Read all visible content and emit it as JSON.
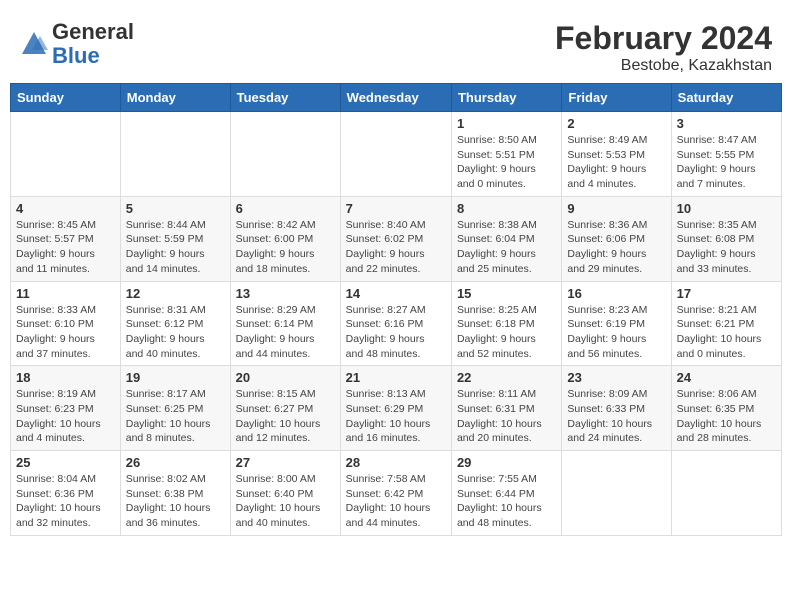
{
  "header": {
    "logo_general": "General",
    "logo_blue": "Blue",
    "month_title": "February 2024",
    "location": "Bestobe, Kazakhstan"
  },
  "weekdays": [
    "Sunday",
    "Monday",
    "Tuesday",
    "Wednesday",
    "Thursday",
    "Friday",
    "Saturday"
  ],
  "weeks": [
    [
      {
        "day": "",
        "info": ""
      },
      {
        "day": "",
        "info": ""
      },
      {
        "day": "",
        "info": ""
      },
      {
        "day": "",
        "info": ""
      },
      {
        "day": "1",
        "info": "Sunrise: 8:50 AM\nSunset: 5:51 PM\nDaylight: 9 hours\nand 0 minutes."
      },
      {
        "day": "2",
        "info": "Sunrise: 8:49 AM\nSunset: 5:53 PM\nDaylight: 9 hours\nand 4 minutes."
      },
      {
        "day": "3",
        "info": "Sunrise: 8:47 AM\nSunset: 5:55 PM\nDaylight: 9 hours\nand 7 minutes."
      }
    ],
    [
      {
        "day": "4",
        "info": "Sunrise: 8:45 AM\nSunset: 5:57 PM\nDaylight: 9 hours\nand 11 minutes."
      },
      {
        "day": "5",
        "info": "Sunrise: 8:44 AM\nSunset: 5:59 PM\nDaylight: 9 hours\nand 14 minutes."
      },
      {
        "day": "6",
        "info": "Sunrise: 8:42 AM\nSunset: 6:00 PM\nDaylight: 9 hours\nand 18 minutes."
      },
      {
        "day": "7",
        "info": "Sunrise: 8:40 AM\nSunset: 6:02 PM\nDaylight: 9 hours\nand 22 minutes."
      },
      {
        "day": "8",
        "info": "Sunrise: 8:38 AM\nSunset: 6:04 PM\nDaylight: 9 hours\nand 25 minutes."
      },
      {
        "day": "9",
        "info": "Sunrise: 8:36 AM\nSunset: 6:06 PM\nDaylight: 9 hours\nand 29 minutes."
      },
      {
        "day": "10",
        "info": "Sunrise: 8:35 AM\nSunset: 6:08 PM\nDaylight: 9 hours\nand 33 minutes."
      }
    ],
    [
      {
        "day": "11",
        "info": "Sunrise: 8:33 AM\nSunset: 6:10 PM\nDaylight: 9 hours\nand 37 minutes."
      },
      {
        "day": "12",
        "info": "Sunrise: 8:31 AM\nSunset: 6:12 PM\nDaylight: 9 hours\nand 40 minutes."
      },
      {
        "day": "13",
        "info": "Sunrise: 8:29 AM\nSunset: 6:14 PM\nDaylight: 9 hours\nand 44 minutes."
      },
      {
        "day": "14",
        "info": "Sunrise: 8:27 AM\nSunset: 6:16 PM\nDaylight: 9 hours\nand 48 minutes."
      },
      {
        "day": "15",
        "info": "Sunrise: 8:25 AM\nSunset: 6:18 PM\nDaylight: 9 hours\nand 52 minutes."
      },
      {
        "day": "16",
        "info": "Sunrise: 8:23 AM\nSunset: 6:19 PM\nDaylight: 9 hours\nand 56 minutes."
      },
      {
        "day": "17",
        "info": "Sunrise: 8:21 AM\nSunset: 6:21 PM\nDaylight: 10 hours\nand 0 minutes."
      }
    ],
    [
      {
        "day": "18",
        "info": "Sunrise: 8:19 AM\nSunset: 6:23 PM\nDaylight: 10 hours\nand 4 minutes."
      },
      {
        "day": "19",
        "info": "Sunrise: 8:17 AM\nSunset: 6:25 PM\nDaylight: 10 hours\nand 8 minutes."
      },
      {
        "day": "20",
        "info": "Sunrise: 8:15 AM\nSunset: 6:27 PM\nDaylight: 10 hours\nand 12 minutes."
      },
      {
        "day": "21",
        "info": "Sunrise: 8:13 AM\nSunset: 6:29 PM\nDaylight: 10 hours\nand 16 minutes."
      },
      {
        "day": "22",
        "info": "Sunrise: 8:11 AM\nSunset: 6:31 PM\nDaylight: 10 hours\nand 20 minutes."
      },
      {
        "day": "23",
        "info": "Sunrise: 8:09 AM\nSunset: 6:33 PM\nDaylight: 10 hours\nand 24 minutes."
      },
      {
        "day": "24",
        "info": "Sunrise: 8:06 AM\nSunset: 6:35 PM\nDaylight: 10 hours\nand 28 minutes."
      }
    ],
    [
      {
        "day": "25",
        "info": "Sunrise: 8:04 AM\nSunset: 6:36 PM\nDaylight: 10 hours\nand 32 minutes."
      },
      {
        "day": "26",
        "info": "Sunrise: 8:02 AM\nSunset: 6:38 PM\nDaylight: 10 hours\nand 36 minutes."
      },
      {
        "day": "27",
        "info": "Sunrise: 8:00 AM\nSunset: 6:40 PM\nDaylight: 10 hours\nand 40 minutes."
      },
      {
        "day": "28",
        "info": "Sunrise: 7:58 AM\nSunset: 6:42 PM\nDaylight: 10 hours\nand 44 minutes."
      },
      {
        "day": "29",
        "info": "Sunrise: 7:55 AM\nSunset: 6:44 PM\nDaylight: 10 hours\nand 48 minutes."
      },
      {
        "day": "",
        "info": ""
      },
      {
        "day": "",
        "info": ""
      }
    ]
  ]
}
